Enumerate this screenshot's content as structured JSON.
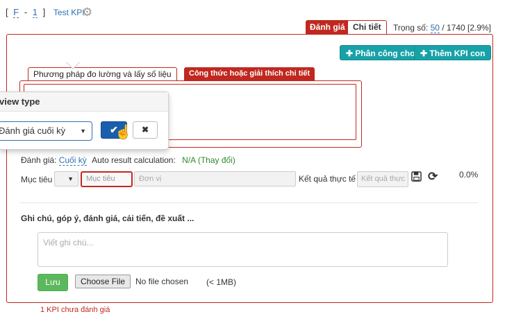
{
  "breadcrumb": {
    "open": "[",
    "part1": "F",
    "sep": "-",
    "part2": "1",
    "close": "]",
    "title": "Test KPI"
  },
  "tabs": {
    "evaluate": "Đánh giá",
    "details": "Chi tiết"
  },
  "weight": {
    "label": "Trọng số:",
    "value": "50",
    "suffix": "/ 1740 [2.9%]"
  },
  "toolbar": {
    "assign_label": "Phân công cho",
    "add_kpi_label": "Thêm KPI con"
  },
  "subtabs": {
    "method": "Phương pháp đo lường và lấy số liệu",
    "formula": "Công thức hoặc giải thích chi tiết"
  },
  "popover": {
    "title": "view type",
    "selected_option": "Đánh giá cuối kỳ",
    "ok_icon": "check-icon",
    "cancel_icon": "close-icon"
  },
  "evaluation": {
    "label": "Đánh giá:",
    "value": "Cuối kỳ",
    "auto_label": "Auto result calculation:",
    "auto_value": "N/A",
    "change_link": "(Thay đổi)"
  },
  "target_row": {
    "label": "Mục tiêu",
    "target_placeholder": "Mục tiêu",
    "unit_placeholder": "Đơn vị",
    "actual_label": "Kết quả thực tế",
    "actual_placeholder": "Kết quả thực",
    "percent": "0.0%"
  },
  "notes": {
    "title": "Ghi chú, góp ý, đánh giá, cải tiến, đề xuất ...",
    "placeholder": "Viết ghi chú...",
    "save_label": "Lưu",
    "choose_file_label": "Choose File",
    "file_status": "No file chosen",
    "file_limit": "(< 1MB)"
  },
  "footer": {
    "note": "1 KPI chưa đánh giá"
  },
  "colors": {
    "accent_red": "#c0281f",
    "teal": "#17a2a8",
    "primary_blue": "#1a5fae",
    "success_green": "#5cb85c",
    "link_blue": "#2f6fb2"
  }
}
